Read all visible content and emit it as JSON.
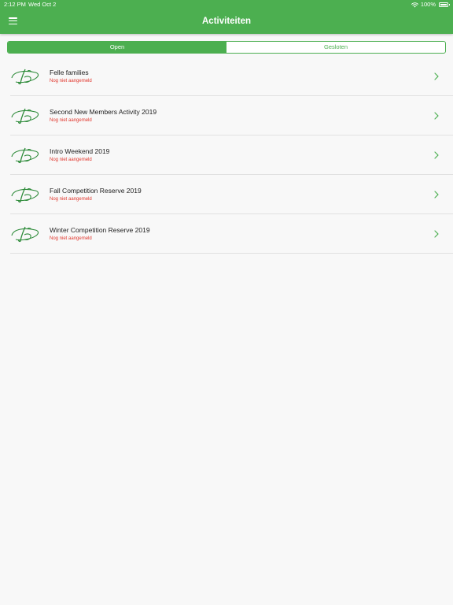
{
  "status_bar": {
    "time": "2:12 PM",
    "date": "Wed Oct 2",
    "battery": "100%",
    "icons": [
      "wifi-icon",
      "battery-icon"
    ]
  },
  "header": {
    "title": "Activiteiten",
    "menu_icon": "menu-icon",
    "color": "#4caf50"
  },
  "tabs": [
    {
      "label": "Open",
      "selected": true
    },
    {
      "label": "Gesloten",
      "selected": false
    }
  ],
  "activities": [
    {
      "title": "Felle families",
      "status": "Nog niet aangemeld"
    },
    {
      "title": "Second New Members Activity 2019",
      "status": "Nog niet aangemeld"
    },
    {
      "title": "Intro Weekend 2019",
      "status": "Nog niet aangemeld"
    },
    {
      "title": "Fall Competition Reserve 2019",
      "status": "Nog niet aangemeld"
    },
    {
      "title": "Winter Competition Reserve 2019",
      "status": "Nog niet aangemeld"
    }
  ],
  "colors": {
    "accent": "#4caf50",
    "status_text": "#e0352b",
    "logo": "#2e8b3a"
  },
  "icons": {
    "row_logo": "club-logo-icon",
    "row_chevron": "chevron-right-icon"
  }
}
